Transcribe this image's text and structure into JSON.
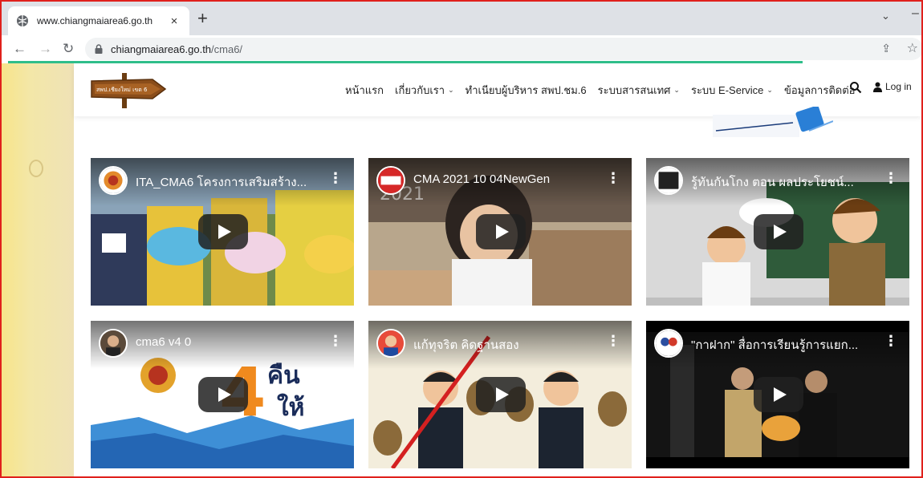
{
  "browser": {
    "tab_title": "www.chiangmaiarea6.go.th",
    "tab_close": "×",
    "new_tab": "+",
    "url_host": "chiangmaiarea6.go.th",
    "url_path": "/cma6/"
  },
  "site": {
    "logo_text": "สพป.เชียงใหม่ เขต 6",
    "menu": [
      {
        "label": "หน้าแรก",
        "caret": ""
      },
      {
        "label": "เกี่ยวกับเรา",
        "caret": "⌄"
      },
      {
        "label": "ทำเนียบผู้บริหาร สพป.ชม.6",
        "caret": ""
      },
      {
        "label": "ระบบสารสนเทศ",
        "caret": "⌄"
      },
      {
        "label": "ระบบ E-Service",
        "caret": "⌄"
      },
      {
        "label": "ข้อมูลการติดต่อ",
        "caret": ""
      }
    ],
    "login_label": "Log in"
  },
  "videos": [
    {
      "title": "ITA_CMA6 โครงการเสริมสร้าง..."
    },
    {
      "title": "CMA 2021 10 04NewGen"
    },
    {
      "title": "รู้ทันกันโกง ตอน ผลประโยชน์..."
    },
    {
      "title": "cma6 v4 0"
    },
    {
      "title": "แก้ทุจริต คิดฐานสอง"
    },
    {
      "title": "\"กาฝาก\" สื่อการเรียนรู้การแยก..."
    }
  ],
  "icons": {
    "back": "back-arrow-icon",
    "forward": "forward-arrow-icon",
    "reload": "reload-icon",
    "lock": "lock-icon",
    "share": "share-icon",
    "star": "bookmark-star-icon",
    "search": "search-icon",
    "user": "user-icon",
    "play": "play-icon",
    "more": "more-vertical-icon"
  },
  "colors": {
    "loading_bar": "#2fbe8a",
    "frame_border": "#e0201c"
  }
}
